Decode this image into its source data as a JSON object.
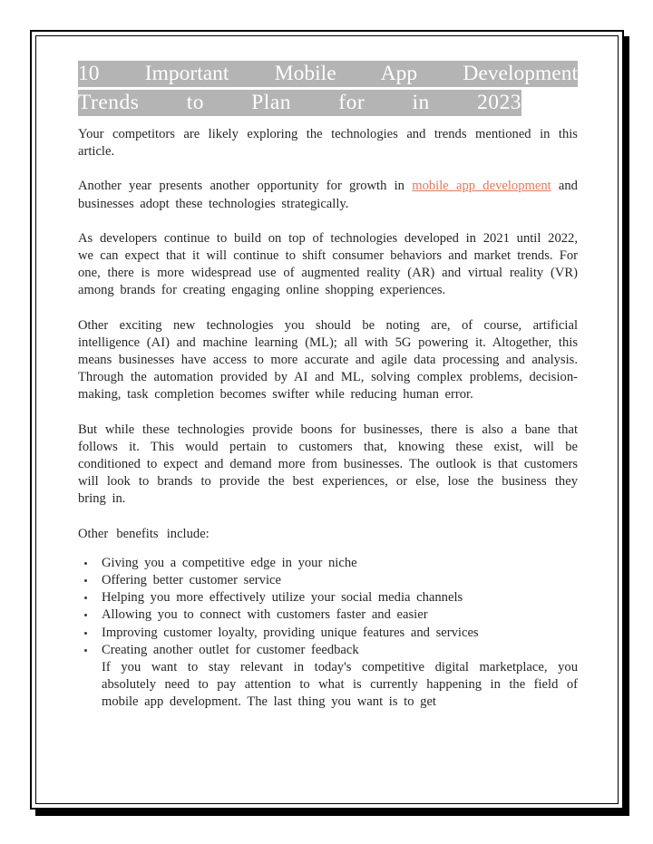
{
  "document": {
    "title": {
      "line1": "10  Important  Mobile  App  Development",
      "line2": "Trends  to  Plan  for  in  2023",
      "highlight_color": "#b4b4b4",
      "text_color": "#ffffff"
    },
    "link_color": "#e0795b",
    "paragraphs": {
      "p1": "Your  competitors  are  likely  exploring  the  technologies  and  trends  mentioned in  this  article.",
      "p2_before_link": "Another  year  presents  another  opportunity  for  growth  in  ",
      "p2_link": "mobile  app  development",
      "p2_after_link": "  and  businesses  adopt  these  technologies  strategically.",
      "p3": "As  developers  continue  to  build  on  top  of  technologies  developed  in  2021 until  2022,  we  can  expect  that  it  will  continue  to  shift  consumer behaviors  and  market  trends.  For  one,  there  is  more  widespread  use  of augmented  reality  (AR)  and  virtual  reality  (VR)  among  brands  for  creating engaging  online  shopping  experiences.",
      "p4": "Other  exciting  new  technologies  you  should  be  noting  are,  of  course, artificial  intelligence  (AI)  and  machine  learning  (ML);  all  with  5G powering  it.  Altogether,  this  means  businesses  have  access  to  more  accurate and  agile  data  processing  and  analysis.  Through  the  automation  provided by  AI  and  ML,  solving  complex  problems,  decision-making,  task  completion becomes  swifter  while  reducing  human  error.",
      "p5": "But  while  these  technologies  provide  boons  for  businesses,  there  is  also  a bane  that  follows  it.  This  would  pertain  to  customers  that,  knowing  these exist,  will  be  conditioned  to  expect  and  demand  more  from  businesses. The  outlook  is  that  customers  will  look  to  brands  to  provide  the  best experiences,  or  else,  lose  the  business  they  bring  in.",
      "p6": "Other   benefits   include:",
      "p_tail": "If  you  want  to  stay  relevant  in  today's  competitive  digital  marketplace, you  absolutely  need  to  pay  attention  to  what  is  currently  happening  in the  field  of  mobile  app  development.  The  last  thing  you  want  is  to  get"
    },
    "bullets": [
      "Giving  you  a  competitive  edge  in  your  niche",
      "Offering  better  customer  service",
      "Helping  you  more  effectively  utilize  your  social  media  channels",
      "Allowing  you  to  connect  with  customers  faster  and  easier",
      "Improving  customer  loyalty,  providing  unique  features  and  services",
      "Creating  another  outlet  for  customer  feedback"
    ]
  }
}
